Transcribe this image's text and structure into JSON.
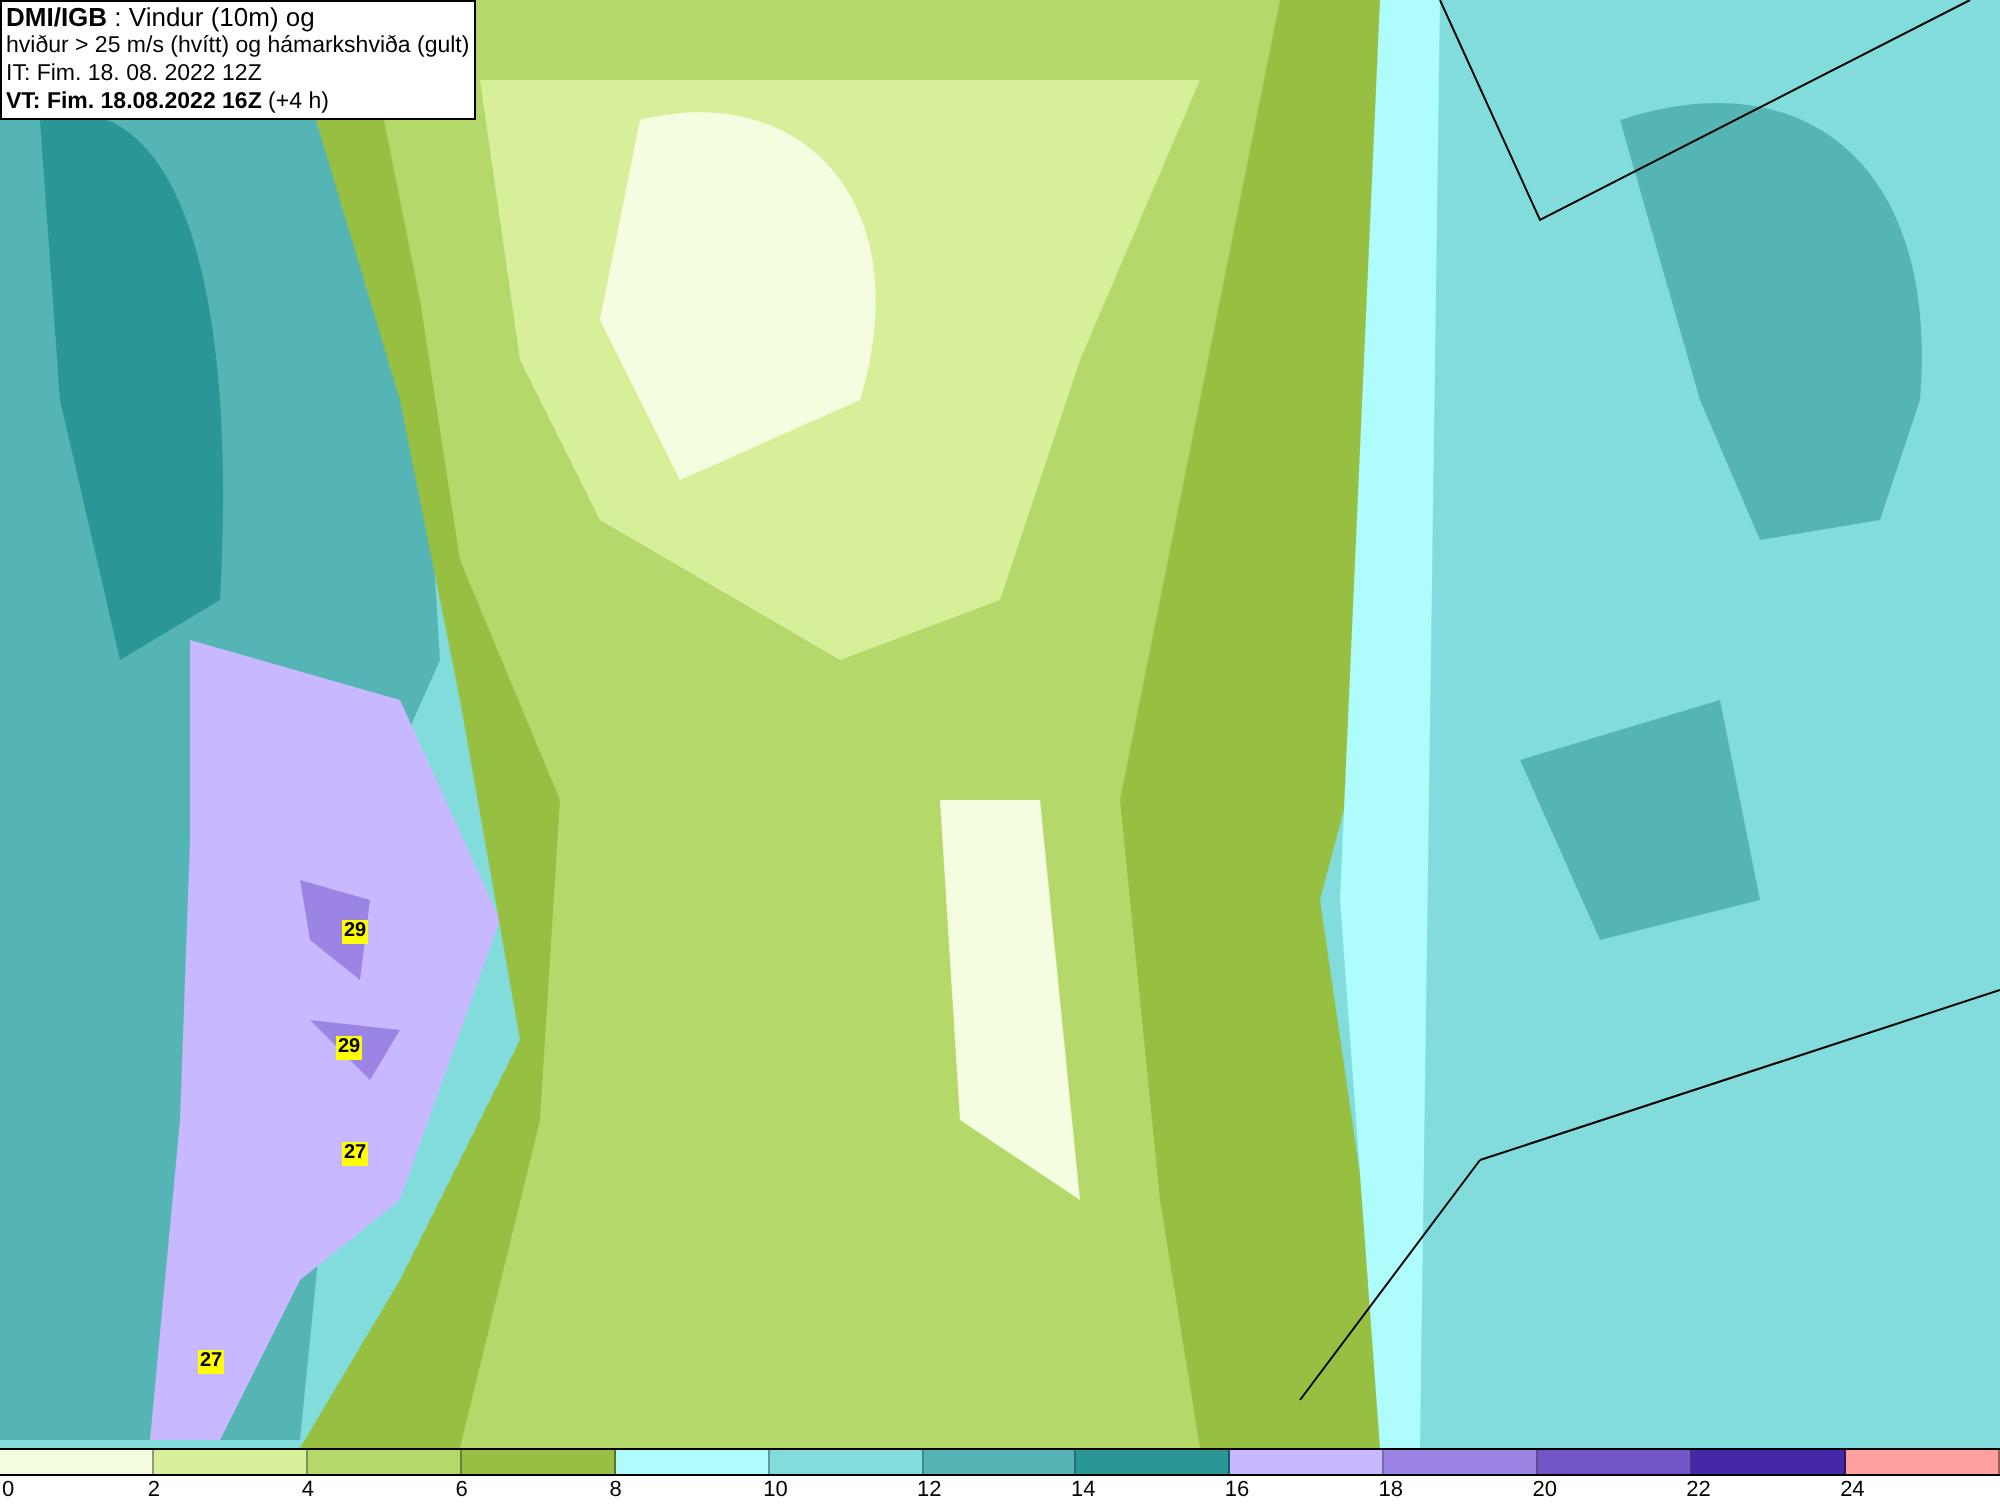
{
  "header": {
    "lines": [
      "**DMI/IGB** : Vindur (10m) og",
      "hviður > 25 m/s (hvítt) og hámarkshviða (gult)",
      "IT: Fim. 18. 08. 2022 12Z",
      "**VT: Fim. 18.08.2022 16Z** (+4 h)"
    ]
  },
  "gust_labels": [
    "29",
    "29",
    "27",
    "27"
  ],
  "legend": {
    "swatches": [
      {
        "color": "#f5fde0"
      },
      {
        "color": "#d8ef9a"
      },
      {
        "color": "#b4d86a"
      },
      {
        "color": "#97c043"
      },
      {
        "color": "#aefcfc"
      },
      {
        "color": "#82dcdc"
      },
      {
        "color": "#55b5b5"
      },
      {
        "color": "#2a9696"
      },
      {
        "color": "#c8b8ff"
      },
      {
        "color": "#9c84e4"
      },
      {
        "color": "#7256c8"
      },
      {
        "color": "#4428a8"
      },
      {
        "color": "#ffa0a0"
      }
    ],
    "ticks": [
      "0",
      "2",
      "4",
      "6",
      "8",
      "10",
      "12",
      "14",
      "16",
      "18",
      "20",
      "22",
      "24"
    ]
  }
}
